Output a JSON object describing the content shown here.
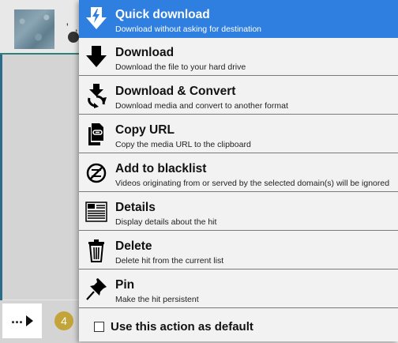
{
  "background": {
    "dots": "' ,",
    "badge_count": "4",
    "more_label": "..."
  },
  "menu": {
    "items": [
      {
        "title": "Quick download",
        "desc": "Download without asking for destination",
        "icon": "quick-download-icon"
      },
      {
        "title": "Download",
        "desc": "Download the file to your hard drive",
        "icon": "download-arrow-icon"
      },
      {
        "title": "Download & Convert",
        "desc": "Download media and convert to another format",
        "icon": "convert-icon"
      },
      {
        "title": "Copy URL",
        "desc": "Copy the media URL to the clipboard",
        "icon": "copy-link-icon"
      },
      {
        "title": "Add to blacklist",
        "desc": "Videos originating from or served by the selected domain(s) will be ignored",
        "icon": "blacklist-icon"
      },
      {
        "title": "Details",
        "desc": "Display details about the hit",
        "icon": "details-icon"
      },
      {
        "title": "Delete",
        "desc": "Delete hit from the current list",
        "icon": "trash-icon"
      },
      {
        "title": "Pin",
        "desc": "Make the hit persistent",
        "icon": "pin-icon"
      }
    ],
    "default_checkbox_label": "Use this action as default",
    "default_checked": false
  },
  "colors": {
    "highlight": "#2e7fe0",
    "badge": "#c2a438"
  }
}
